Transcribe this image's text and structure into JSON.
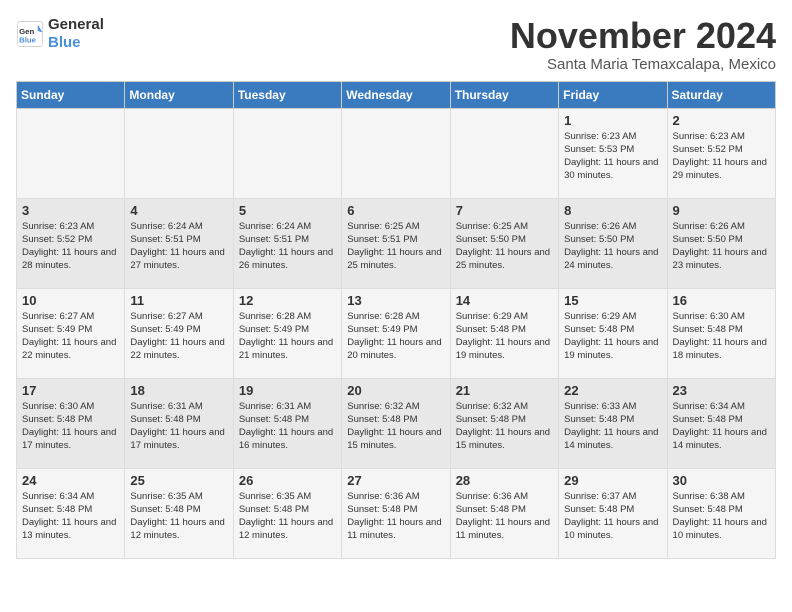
{
  "logo": {
    "line1": "General",
    "line2": "Blue"
  },
  "title": "November 2024",
  "location": "Santa Maria Temaxcalapa, Mexico",
  "weekdays": [
    "Sunday",
    "Monday",
    "Tuesday",
    "Wednesday",
    "Thursday",
    "Friday",
    "Saturday"
  ],
  "weeks": [
    [
      {
        "day": "",
        "info": ""
      },
      {
        "day": "",
        "info": ""
      },
      {
        "day": "",
        "info": ""
      },
      {
        "day": "",
        "info": ""
      },
      {
        "day": "",
        "info": ""
      },
      {
        "day": "1",
        "info": "Sunrise: 6:23 AM\nSunset: 5:53 PM\nDaylight: 11 hours and 30 minutes."
      },
      {
        "day": "2",
        "info": "Sunrise: 6:23 AM\nSunset: 5:52 PM\nDaylight: 11 hours and 29 minutes."
      }
    ],
    [
      {
        "day": "3",
        "info": "Sunrise: 6:23 AM\nSunset: 5:52 PM\nDaylight: 11 hours and 28 minutes."
      },
      {
        "day": "4",
        "info": "Sunrise: 6:24 AM\nSunset: 5:51 PM\nDaylight: 11 hours and 27 minutes."
      },
      {
        "day": "5",
        "info": "Sunrise: 6:24 AM\nSunset: 5:51 PM\nDaylight: 11 hours and 26 minutes."
      },
      {
        "day": "6",
        "info": "Sunrise: 6:25 AM\nSunset: 5:51 PM\nDaylight: 11 hours and 25 minutes."
      },
      {
        "day": "7",
        "info": "Sunrise: 6:25 AM\nSunset: 5:50 PM\nDaylight: 11 hours and 25 minutes."
      },
      {
        "day": "8",
        "info": "Sunrise: 6:26 AM\nSunset: 5:50 PM\nDaylight: 11 hours and 24 minutes."
      },
      {
        "day": "9",
        "info": "Sunrise: 6:26 AM\nSunset: 5:50 PM\nDaylight: 11 hours and 23 minutes."
      }
    ],
    [
      {
        "day": "10",
        "info": "Sunrise: 6:27 AM\nSunset: 5:49 PM\nDaylight: 11 hours and 22 minutes."
      },
      {
        "day": "11",
        "info": "Sunrise: 6:27 AM\nSunset: 5:49 PM\nDaylight: 11 hours and 22 minutes."
      },
      {
        "day": "12",
        "info": "Sunrise: 6:28 AM\nSunset: 5:49 PM\nDaylight: 11 hours and 21 minutes."
      },
      {
        "day": "13",
        "info": "Sunrise: 6:28 AM\nSunset: 5:49 PM\nDaylight: 11 hours and 20 minutes."
      },
      {
        "day": "14",
        "info": "Sunrise: 6:29 AM\nSunset: 5:48 PM\nDaylight: 11 hours and 19 minutes."
      },
      {
        "day": "15",
        "info": "Sunrise: 6:29 AM\nSunset: 5:48 PM\nDaylight: 11 hours and 19 minutes."
      },
      {
        "day": "16",
        "info": "Sunrise: 6:30 AM\nSunset: 5:48 PM\nDaylight: 11 hours and 18 minutes."
      }
    ],
    [
      {
        "day": "17",
        "info": "Sunrise: 6:30 AM\nSunset: 5:48 PM\nDaylight: 11 hours and 17 minutes."
      },
      {
        "day": "18",
        "info": "Sunrise: 6:31 AM\nSunset: 5:48 PM\nDaylight: 11 hours and 17 minutes."
      },
      {
        "day": "19",
        "info": "Sunrise: 6:31 AM\nSunset: 5:48 PM\nDaylight: 11 hours and 16 minutes."
      },
      {
        "day": "20",
        "info": "Sunrise: 6:32 AM\nSunset: 5:48 PM\nDaylight: 11 hours and 15 minutes."
      },
      {
        "day": "21",
        "info": "Sunrise: 6:32 AM\nSunset: 5:48 PM\nDaylight: 11 hours and 15 minutes."
      },
      {
        "day": "22",
        "info": "Sunrise: 6:33 AM\nSunset: 5:48 PM\nDaylight: 11 hours and 14 minutes."
      },
      {
        "day": "23",
        "info": "Sunrise: 6:34 AM\nSunset: 5:48 PM\nDaylight: 11 hours and 14 minutes."
      }
    ],
    [
      {
        "day": "24",
        "info": "Sunrise: 6:34 AM\nSunset: 5:48 PM\nDaylight: 11 hours and 13 minutes."
      },
      {
        "day": "25",
        "info": "Sunrise: 6:35 AM\nSunset: 5:48 PM\nDaylight: 11 hours and 12 minutes."
      },
      {
        "day": "26",
        "info": "Sunrise: 6:35 AM\nSunset: 5:48 PM\nDaylight: 11 hours and 12 minutes."
      },
      {
        "day": "27",
        "info": "Sunrise: 6:36 AM\nSunset: 5:48 PM\nDaylight: 11 hours and 11 minutes."
      },
      {
        "day": "28",
        "info": "Sunrise: 6:36 AM\nSunset: 5:48 PM\nDaylight: 11 hours and 11 minutes."
      },
      {
        "day": "29",
        "info": "Sunrise: 6:37 AM\nSunset: 5:48 PM\nDaylight: 11 hours and 10 minutes."
      },
      {
        "day": "30",
        "info": "Sunrise: 6:38 AM\nSunset: 5:48 PM\nDaylight: 11 hours and 10 minutes."
      }
    ]
  ]
}
